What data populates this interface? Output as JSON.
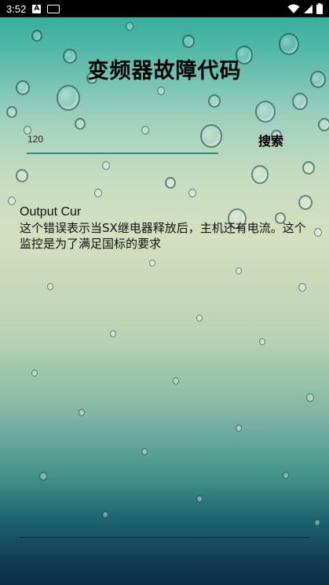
{
  "status_bar": {
    "time": "3:52",
    "notification_letter": "A"
  },
  "page": {
    "title": "变频器故障代码"
  },
  "search": {
    "value": "120",
    "button_label": "搜索"
  },
  "result": {
    "code": "Output Cur",
    "description": "这个错误表示当SX继电器释放后，主机还有电流。这个监控是为了满足国标的要求"
  },
  "colors": {
    "status_bar": "#000000",
    "input_underline": "#3a8a82",
    "text": "#000000"
  },
  "icons": [
    "notification-a-icon",
    "keyboard-icon",
    "wifi-icon",
    "signal-icon",
    "battery-icon"
  ]
}
